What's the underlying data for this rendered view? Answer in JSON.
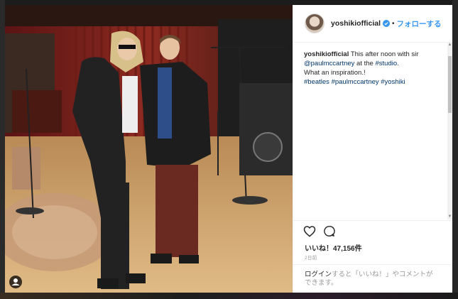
{
  "post": {
    "username": "yoshikiofficial",
    "separator": "•",
    "follow_label": "フォローする",
    "caption": {
      "author": "yoshikiofficial",
      "text_1": " This after noon with sir ",
      "mention": "@paulmccartney",
      "text_2": " at the ",
      "hashtag_studio": "#studio",
      "text_3": ".",
      "line_2": "What an inspiration.!",
      "hashtags": [
        "#beatles",
        "#paulmccartney",
        "#yoshiki"
      ]
    },
    "likes": "いいね！47,156件",
    "time": "2日前",
    "login_link": "ログイン",
    "login_rest": "すると「いいね！」やコメントができます。"
  },
  "icons": {
    "verified": "verified-badge-icon",
    "like": "heart-icon",
    "comment": "comment-bubble-icon",
    "user_tag": "user-tag-icon"
  },
  "colors": {
    "accent": "#3897f0",
    "link": "#003569",
    "text": "#262626",
    "muted": "#999999"
  }
}
